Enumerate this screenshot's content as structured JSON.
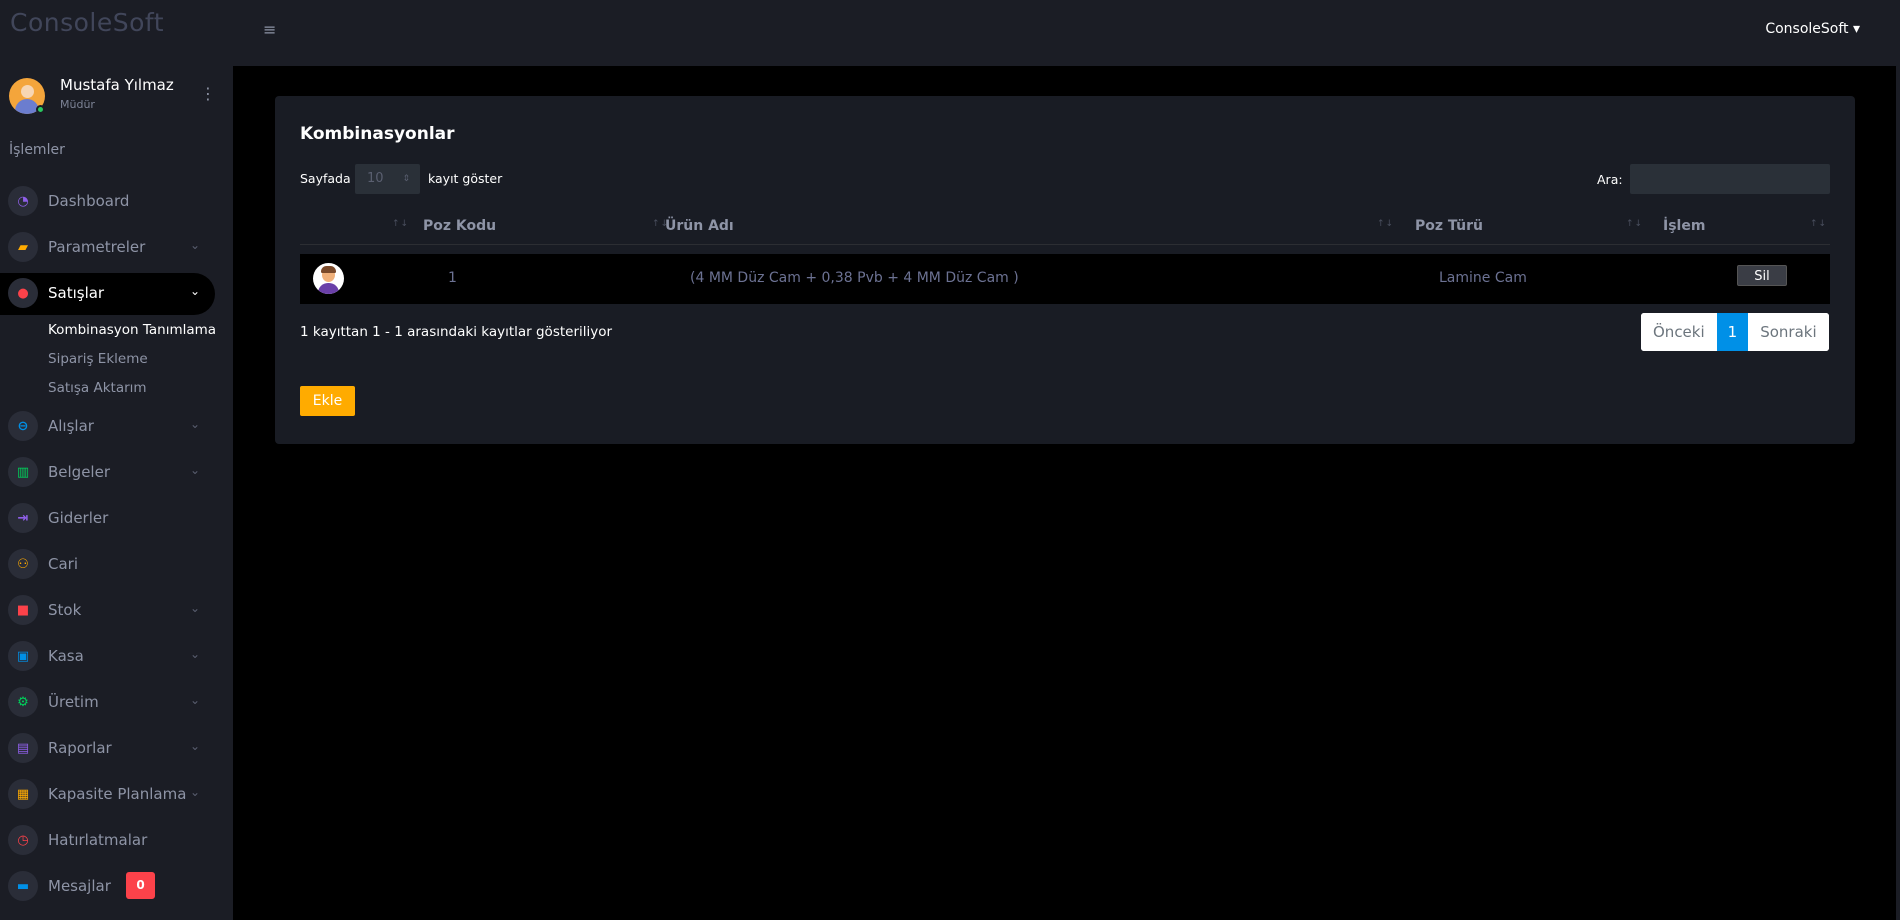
{
  "brand": "ConsoleSoft",
  "user": {
    "name": "Mustafa Yılmaz",
    "role": "Müdür"
  },
  "topbar": {
    "account": "ConsoleSoft ▾"
  },
  "sidebar": {
    "section": "İşlemler",
    "items": [
      {
        "label": "Dashboard",
        "icon": "dashboard-gauge-icon",
        "color": "#8f5fe8",
        "glyph": "◔",
        "chevron": ""
      },
      {
        "label": "Parametreler",
        "icon": "layers-icon",
        "color": "#ffab00",
        "glyph": "▰",
        "chevron": "⌄"
      },
      {
        "label": "Satışlar",
        "icon": "sales-icon",
        "color": "#fc424a",
        "glyph": "●",
        "chevron": "⌄"
      },
      {
        "label": "Alışlar",
        "icon": "purchases-icon",
        "color": "#0090e7",
        "glyph": "⊖",
        "chevron": "⌄"
      },
      {
        "label": "Belgeler",
        "icon": "documents-book-icon",
        "color": "#00d25b",
        "glyph": "▥",
        "chevron": "⌄"
      },
      {
        "label": "Giderler",
        "icon": "expenses-arrow-icon",
        "color": "#8f5fe8",
        "glyph": "⇥",
        "chevron": ""
      },
      {
        "label": "Cari",
        "icon": "accounts-people-icon",
        "color": "#ffab00",
        "glyph": "⚇",
        "chevron": ""
      },
      {
        "label": "Stok",
        "icon": "stock-icon",
        "color": "#fc424a",
        "glyph": "■",
        "chevron": "⌄"
      },
      {
        "label": "Kasa",
        "icon": "cashbox-icon",
        "color": "#0090e7",
        "glyph": "▣",
        "chevron": "⌄"
      },
      {
        "label": "Üretim",
        "icon": "production-icon",
        "color": "#00d25b",
        "glyph": "⚙",
        "chevron": "⌄"
      },
      {
        "label": "Raporlar",
        "icon": "reports-icon",
        "color": "#8f5fe8",
        "glyph": "▤",
        "chevron": "⌄"
      },
      {
        "label": "Kapasite Planlama",
        "icon": "clipboard-icon",
        "color": "#ffab00",
        "glyph": "▦",
        "chevron": "⌄"
      },
      {
        "label": "Hatırlatmalar",
        "icon": "reminder-icon",
        "color": "#fc424a",
        "glyph": "◷",
        "chevron": ""
      },
      {
        "label": "Mesajlar",
        "icon": "messages-icon",
        "color": "#0090e7",
        "glyph": "▬",
        "chevron": ""
      }
    ],
    "sales_subitems": [
      "Kombinasyon Tanımlama",
      "Sipariş Ekleme",
      "Satışa Aktarım"
    ],
    "messages_badge": "0"
  },
  "card": {
    "title": "Kombinasyonlar",
    "length_prefix": "Sayfada",
    "length_value": "10",
    "length_suffix": "kayıt göster",
    "search_label": "Ara:",
    "search_value": "",
    "columns": [
      "",
      "Poz Kodu",
      "Ürün Adı",
      "Poz Türü",
      "İşlem"
    ],
    "rows": [
      {
        "poz_kodu": "1",
        "urun_adi": "(4 MM Düz Cam + 0,38 Pvb + 4 MM Düz Cam )",
        "poz_turu": "Lamine Cam",
        "action": "Sil"
      }
    ],
    "info": "1 kayıttan 1 - 1 arasındaki kayıtlar gösteriliyor",
    "pager": {
      "prev": "Önceki",
      "current": "1",
      "next": "Sonraki"
    },
    "add_button": "Ekle"
  }
}
